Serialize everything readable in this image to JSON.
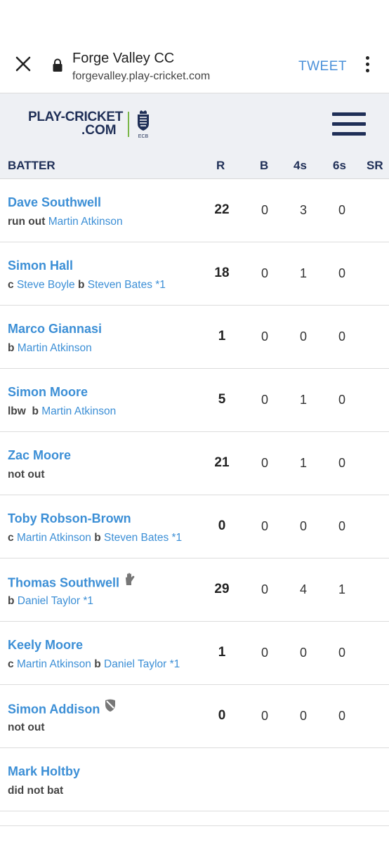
{
  "browser": {
    "title": "Forge Valley CC",
    "url": "forgevalley.play-cricket.com",
    "tweet_label": "TWEET"
  },
  "brand": {
    "line1": "PLAY-CRICKET",
    "line2": ".COM",
    "ecb": "ECB",
    "navy": "#1f2f57",
    "blue": "#3c8fd6",
    "green": "#7ab648"
  },
  "columns": {
    "batter": "BATTER",
    "r": "R",
    "b": "B",
    "fours": "4s",
    "sixes": "6s",
    "sr": "SR"
  },
  "batters": [
    {
      "name": "Dave Southwell",
      "how": [
        [
          "run out ",
          "k"
        ],
        [
          "Martin Atkinson",
          "p"
        ]
      ],
      "r": "22",
      "b": "0",
      "fours": "3",
      "sixes": "0",
      "badge": ""
    },
    {
      "name": "Simon Hall",
      "how": [
        [
          "c ",
          "k"
        ],
        [
          "Steve Boyle",
          "p"
        ],
        [
          " b ",
          "k"
        ],
        [
          "Steven Bates *1",
          "p"
        ]
      ],
      "r": "18",
      "b": "0",
      "fours": "1",
      "sixes": "0",
      "badge": ""
    },
    {
      "name": "Marco Giannasi",
      "how": [
        [
          "b ",
          "k"
        ],
        [
          "Martin Atkinson",
          "p"
        ]
      ],
      "r": "1",
      "b": "0",
      "fours": "0",
      "sixes": "0",
      "badge": ""
    },
    {
      "name": "Simon Moore",
      "how": [
        [
          "lbw  b ",
          "k"
        ],
        [
          "Martin Atkinson",
          "p"
        ]
      ],
      "r": "5",
      "b": "0",
      "fours": "1",
      "sixes": "0",
      "badge": ""
    },
    {
      "name": "Zac Moore",
      "how": [
        [
          "not out",
          "k"
        ]
      ],
      "r": "21",
      "b": "0",
      "fours": "1",
      "sixes": "0",
      "badge": ""
    },
    {
      "name": "Toby Robson-Brown",
      "how": [
        [
          "c ",
          "k"
        ],
        [
          "Martin Atkinson",
          "p"
        ],
        [
          " b ",
          "k"
        ],
        [
          "Steven Bates *1",
          "p"
        ]
      ],
      "r": "0",
      "b": "0",
      "fours": "0",
      "sixes": "0",
      "badge": ""
    },
    {
      "name": "Thomas Southwell",
      "how": [
        [
          "b ",
          "k"
        ],
        [
          "Daniel Taylor *1",
          "p"
        ]
      ],
      "r": "29",
      "b": "0",
      "fours": "4",
      "sixes": "1",
      "badge": "wicket-keeper-glove-icon"
    },
    {
      "name": "Keely Moore",
      "how": [
        [
          "c ",
          "k"
        ],
        [
          "Martin Atkinson",
          "p"
        ],
        [
          " b ",
          "k"
        ],
        [
          "Daniel Taylor *1",
          "p"
        ]
      ],
      "r": "1",
      "b": "0",
      "fours": "0",
      "sixes": "0",
      "badge": ""
    },
    {
      "name": "Simon Addison",
      "how": [
        [
          "not out",
          "k"
        ]
      ],
      "r": "0",
      "b": "0",
      "fours": "0",
      "sixes": "0",
      "badge": "captain-shield-icon"
    },
    {
      "name": "Mark Holtby",
      "how": [
        [
          "did not bat",
          "k"
        ]
      ],
      "r": "",
      "b": "",
      "fours": "",
      "sixes": "",
      "badge": ""
    }
  ]
}
